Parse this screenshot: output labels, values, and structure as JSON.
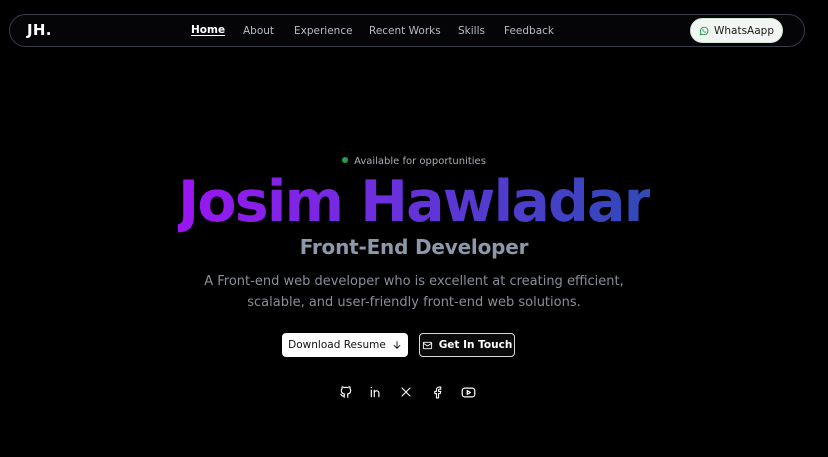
{
  "brand": {
    "logo": "JH."
  },
  "nav": {
    "items": [
      {
        "label": "Home",
        "active": true
      },
      {
        "label": "About"
      },
      {
        "label": "Experience"
      },
      {
        "label": "Recent Works"
      },
      {
        "label": "Skills"
      },
      {
        "label": "Feedback"
      }
    ],
    "cta": {
      "label": "WhatsAapp",
      "icon": "whatsapp-icon"
    }
  },
  "hero": {
    "status": "Available for opportunities",
    "status_color": "#1fa34a",
    "name": "Josim Hawladar",
    "name_gradient": [
      "#9a16f2",
      "#2f4ab8"
    ],
    "role": "Front-End Developer",
    "description_lines": [
      "A Front-end web developer who is excellent at creating efficient,",
      "scalable, and user-friendly front-end web solutions."
    ],
    "buttons": {
      "download": {
        "label": "Download Resume",
        "icon": "arrow-down-icon"
      },
      "contact": {
        "label": "Get In Touch",
        "icon": "mail-icon"
      }
    },
    "socials": [
      {
        "icon": "github-icon"
      },
      {
        "icon": "linkedin-icon"
      },
      {
        "icon": "x-icon"
      },
      {
        "icon": "facebook-icon"
      },
      {
        "icon": "youtube-icon"
      }
    ]
  }
}
